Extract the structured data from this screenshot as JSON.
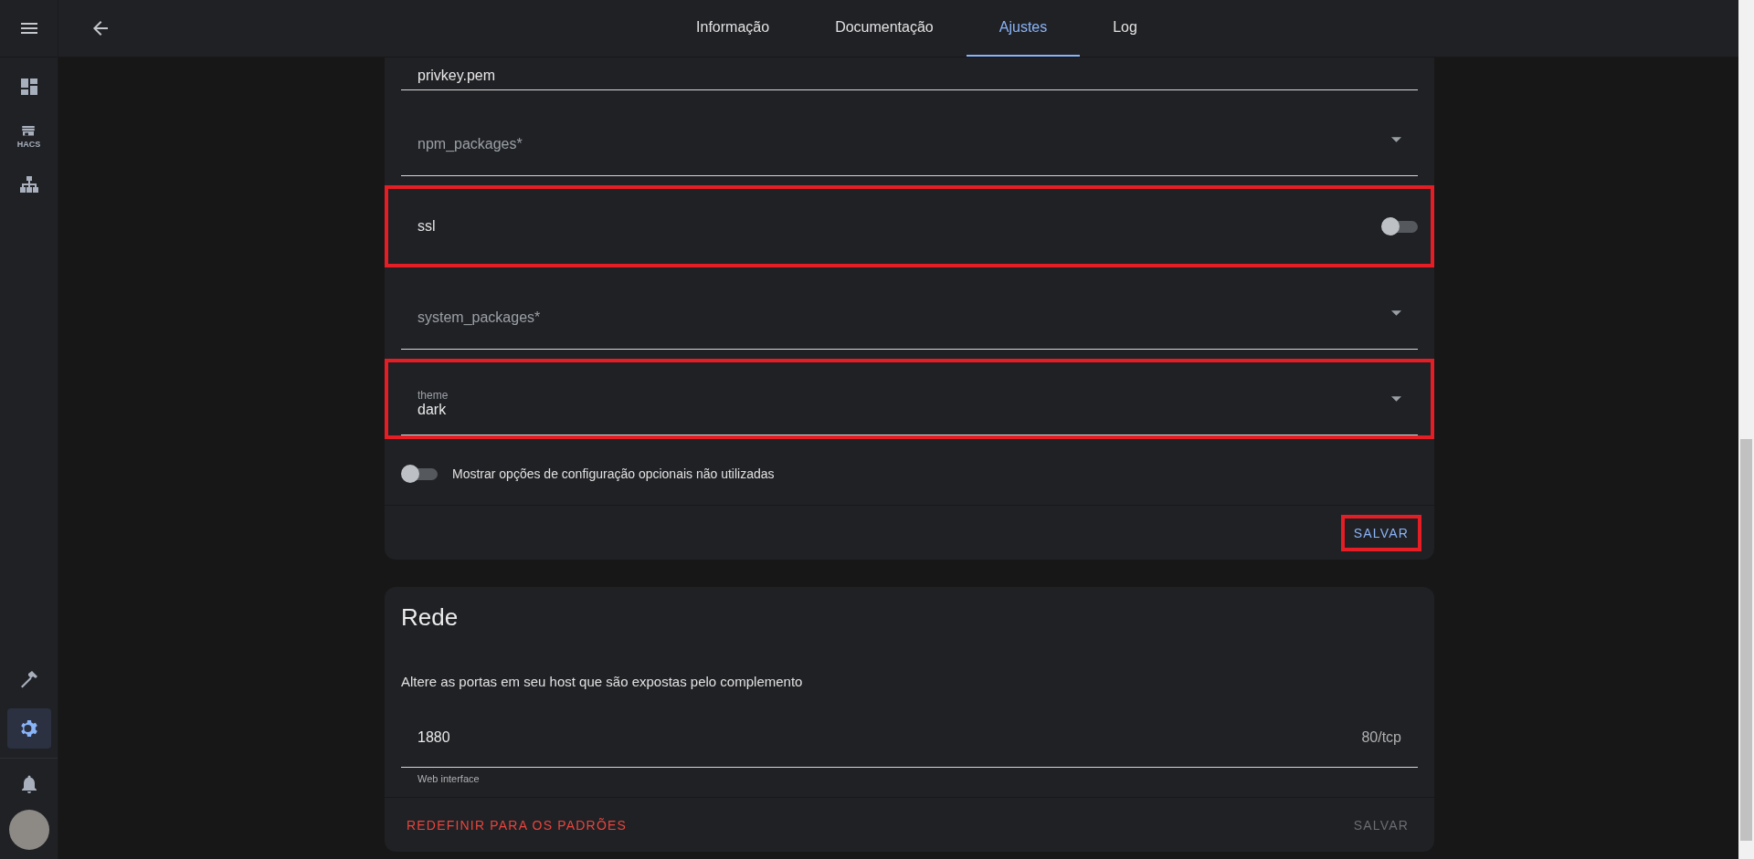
{
  "tabs": [
    {
      "label": "Informação",
      "selected": false
    },
    {
      "label": "Documentação",
      "selected": false
    },
    {
      "label": "Ajustes",
      "selected": true
    },
    {
      "label": "Log",
      "selected": false
    }
  ],
  "sidebar": {
    "items": [
      {
        "kind": "dashboard",
        "selected": false
      },
      {
        "kind": "store",
        "badge": "HACS",
        "selected": false
      },
      {
        "kind": "hierarchy",
        "selected": false
      },
      {
        "kind": "hammer",
        "selected": false
      },
      {
        "kind": "gear",
        "selected": true
      }
    ]
  },
  "config": {
    "fields": [
      {
        "kind": "text",
        "value": "privkey.pem",
        "highlighted": false
      },
      {
        "kind": "select",
        "placeholder": "npm_packages*",
        "highlighted": false
      },
      {
        "kind": "toggle",
        "label": "ssl",
        "on": false,
        "highlighted": true
      },
      {
        "kind": "select",
        "placeholder": "system_packages*",
        "highlighted": false
      },
      {
        "kind": "select",
        "label": "theme",
        "value": "dark",
        "highlighted": true
      }
    ],
    "optional_toggle": {
      "label": "Mostrar opções de configuração opcionais não utilizadas",
      "on": false
    },
    "save_button": {
      "label": "SALVAR",
      "disabled": false,
      "highlighted": true
    }
  },
  "network": {
    "title": "Rede",
    "description": "Altere as portas em seu host que são expostas pelo complemento",
    "ports": [
      {
        "value": "1880",
        "suffix": "80/tcp",
        "helper": "Web interface"
      }
    ],
    "reset_button": "REDEFINIR PARA OS PADRÕES",
    "save_button": {
      "label": "SALVAR",
      "disabled": true,
      "highlighted": false
    }
  }
}
